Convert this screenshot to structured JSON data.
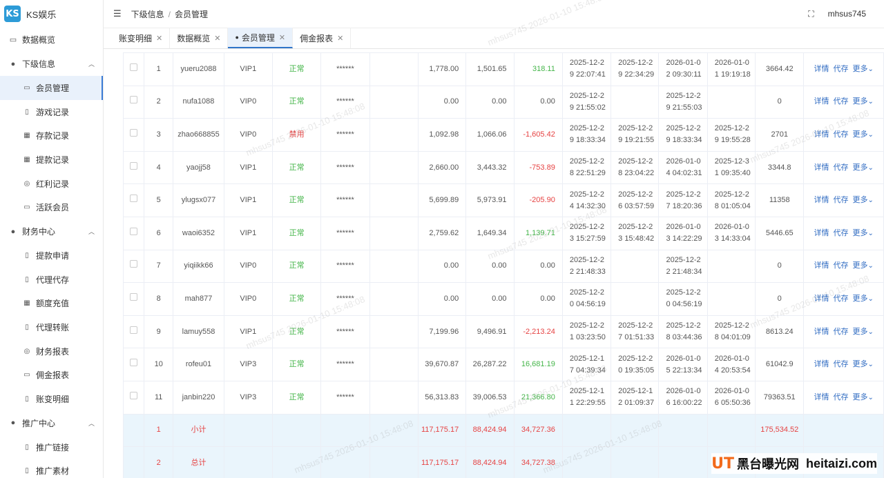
{
  "app": {
    "logo_mark": "KS",
    "title": "KS娱乐"
  },
  "sidebar": {
    "overview": {
      "icon": "monitor-icon",
      "label": "数据概览"
    },
    "groups": [
      {
        "label": "下级信息",
        "items": [
          "会员管理",
          "游戏记录",
          "存款记录",
          "提款记录",
          "红利记录",
          "活跃会员"
        ]
      },
      {
        "label": "财务中心",
        "items": [
          "提款申请",
          "代理代存",
          "额度充值",
          "代理转账",
          "财务报表",
          "佣金报表",
          "账变明细"
        ]
      },
      {
        "label": "推广中心",
        "items": [
          "推广链接",
          "推广素材"
        ]
      }
    ]
  },
  "header": {
    "breadcrumb": [
      "下级信息",
      "会员管理"
    ],
    "user": "mhsus745"
  },
  "tabs": [
    {
      "label": "账变明细",
      "active": false
    },
    {
      "label": "数据概览",
      "active": false
    },
    {
      "label": "会员管理",
      "active": true
    },
    {
      "label": "佣金报表",
      "active": false
    }
  ],
  "table": {
    "rows": [
      {
        "no": "1",
        "user": "yueru2088",
        "vip": "VIP1",
        "status": "正常",
        "pwd": "******",
        "a": "1,778.00",
        "b": "1,501.65",
        "c": "318.11",
        "cc": "g",
        "d1": "2025-12-29 22:07:41",
        "d2": "2025-12-29 22:34:29",
        "d3": "2026-01-02 09:30:11",
        "d4": "2026-01-01 19:19:18",
        "bal": "3664.42"
      },
      {
        "no": "2",
        "user": "nufa1088",
        "vip": "VIP0",
        "status": "正常",
        "pwd": "******",
        "a": "0.00",
        "b": "0.00",
        "c": "0.00",
        "cc": "",
        "d1": "2025-12-29 21:55:02",
        "d2": "",
        "d3": "2025-12-29 21:55:03",
        "d4": "",
        "bal": "0"
      },
      {
        "no": "3",
        "user": "zhao668855",
        "vip": "VIP0",
        "status": "禁用",
        "pwd": "******",
        "a": "1,092.98",
        "b": "1,066.06",
        "c": "-1,605.42",
        "cc": "r",
        "d1": "2025-12-29 18:33:34",
        "d2": "2025-12-29 19:21:55",
        "d3": "2025-12-29 18:33:34",
        "d4": "2025-12-29 19:55:28",
        "bal": "2701"
      },
      {
        "no": "4",
        "user": "yaojj58",
        "vip": "VIP1",
        "status": "正常",
        "pwd": "******",
        "a": "2,660.00",
        "b": "3,443.32",
        "c": "-753.89",
        "cc": "r",
        "d1": "2025-12-28 22:51:29",
        "d2": "2025-12-28 23:04:22",
        "d3": "2026-01-04 04:02:31",
        "d4": "2025-12-31 09:35:40",
        "bal": "3344.8"
      },
      {
        "no": "5",
        "user": "ylugsx077",
        "vip": "VIP1",
        "status": "正常",
        "pwd": "******",
        "a": "5,699.89",
        "b": "5,973.91",
        "c": "-205.90",
        "cc": "r",
        "d1": "2025-12-24 14:32:30",
        "d2": "2025-12-26 03:57:59",
        "d3": "2025-12-27 18:20:36",
        "d4": "2025-12-28 01:05:04",
        "bal": "11358"
      },
      {
        "no": "6",
        "user": "waoi6352",
        "vip": "VIP1",
        "status": "正常",
        "pwd": "******",
        "a": "2,759.62",
        "b": "1,649.34",
        "c": "1,139.71",
        "cc": "g",
        "d1": "2025-12-23 15:27:59",
        "d2": "2025-12-23 15:48:42",
        "d3": "2026-01-03 14:22:29",
        "d4": "2026-01-03 14:33:04",
        "bal": "5446.65"
      },
      {
        "no": "7",
        "user": "yiqiikk66",
        "vip": "VIP0",
        "status": "正常",
        "pwd": "******",
        "a": "0.00",
        "b": "0.00",
        "c": "0.00",
        "cc": "",
        "d1": "2025-12-22 21:48:33",
        "d2": "",
        "d3": "2025-12-22 21:48:34",
        "d4": "",
        "bal": "0"
      },
      {
        "no": "8",
        "user": "mah877",
        "vip": "VIP0",
        "status": "正常",
        "pwd": "******",
        "a": "0.00",
        "b": "0.00",
        "c": "0.00",
        "cc": "",
        "d1": "2025-12-20 04:56:19",
        "d2": "",
        "d3": "2025-12-20 04:56:19",
        "d4": "",
        "bal": "0"
      },
      {
        "no": "9",
        "user": "lamuy558",
        "vip": "VIP1",
        "status": "正常",
        "pwd": "******",
        "a": "7,199.96",
        "b": "9,496.91",
        "c": "-2,213.24",
        "cc": "r",
        "d1": "2025-12-21 03:23:50",
        "d2": "2025-12-27 01:51:33",
        "d3": "2025-12-28 03:44:36",
        "d4": "2025-12-28 04:01:09",
        "bal": "8613.24"
      },
      {
        "no": "10",
        "user": "rofeu01",
        "vip": "VIP3",
        "status": "正常",
        "pwd": "******",
        "a": "39,670.87",
        "b": "26,287.22",
        "c": "16,681.19",
        "cc": "g",
        "d1": "2025-12-17 04:39:34",
        "d2": "2025-12-20 19:35:05",
        "d3": "2026-01-05 22:13:34",
        "d4": "2026-01-04 20:53:54",
        "bal": "61042.9"
      },
      {
        "no": "11",
        "user": "janbin220",
        "vip": "VIP3",
        "status": "正常",
        "pwd": "******",
        "a": "56,313.83",
        "b": "39,006.53",
        "c": "21,366.80",
        "cc": "g",
        "d1": "2025-12-11 22:29:55",
        "d2": "2025-12-12 01:09:37",
        "d3": "2026-01-06 16:00:22",
        "d4": "2026-01-06 05:50:36",
        "bal": "79363.51"
      }
    ],
    "actions": {
      "detail": "详情",
      "deposit": "代存",
      "more": "更多"
    },
    "summary": [
      {
        "no": "1",
        "label": "小计",
        "a": "117,175.17",
        "b": "88,424.94",
        "c": "34,727.36",
        "bal": "175,534.52"
      },
      {
        "no": "2",
        "label": "总计",
        "a": "117,175.17",
        "b": "88,424.94",
        "c": "34,727.38",
        "bal": ""
      }
    ]
  },
  "watermark": "mhsus745 2026-01-10 15:48:08",
  "brand": {
    "logo": "UT",
    "name": "黑台曝光网",
    "url": "heitaizi.com"
  }
}
